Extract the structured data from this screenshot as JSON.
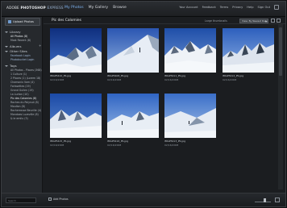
{
  "app": {
    "brand_prefix": "ADOBE",
    "brand_name": "PHOTOSHOP",
    "brand_suffix": "EXPRESS",
    "tabs": [
      {
        "label": "My Photos",
        "active": true
      },
      {
        "label": "My Gallery",
        "active": false
      },
      {
        "label": "Browse",
        "active": false
      }
    ],
    "toplinks": [
      "Your Account",
      "Feedback",
      "Terms",
      "Privacy",
      "Help",
      "Sign Out"
    ]
  },
  "sidebar": {
    "upload_label": "Upload Photos",
    "sections": [
      {
        "label": "Library",
        "items": [
          {
            "label": "All Photos (8)",
            "active": true
          },
          {
            "label": "Most Recent (8)",
            "active": false
          }
        ]
      },
      {
        "label": "Albums",
        "items": []
      },
      {
        "label": "Other Sites",
        "items": [
          {
            "label": "Facebook Login",
            "link": true
          },
          {
            "label": "Photobucket Login",
            "link": true
          }
        ]
      },
      {
        "label": "Tags",
        "items": [
          {
            "label": "All Photos - Places (368)"
          },
          {
            "label": "1 Culture (1)"
          },
          {
            "label": "2 Places (1) (Lorem 18)"
          },
          {
            "label": "Chamonix Vom (4)"
          },
          {
            "label": "Forissettes (19)"
          },
          {
            "label": "Grand Gullen (19)"
          },
          {
            "label": "La Lurtan (10)"
          },
          {
            "label": "Pic des Calomies (8)"
          },
          {
            "label": "Roches du Polyrud (8)"
          },
          {
            "label": "Moullon (8)"
          },
          {
            "label": "Rocherrosse Beurille (4)"
          },
          {
            "label": "Mondoes Luzeville (8)"
          },
          {
            "label": "& le emilu (3)"
          }
        ]
      }
    ]
  },
  "main": {
    "album_title": "Pic des Calomies",
    "view_label": "Large thumbnails",
    "sort_value": "View: By Newest Date",
    "photos": [
      {
        "filename": "IMGP5410_PS.jpg",
        "date": "02/16/2008"
      },
      {
        "filename": "IMGP5408_PS.jpg",
        "date": "02/16/2008"
      },
      {
        "filename": "IMGP5411_PS.jpg",
        "date": "02/16/2008"
      },
      {
        "filename": "IMGP5412_PS.jpg",
        "date": "02/16/2008"
      },
      {
        "filename": "IMGP5415_PS.jpg",
        "date": "02/16/2008"
      },
      {
        "filename": "IMGP5416_PS.jpg",
        "date": "02/16/2008"
      },
      {
        "filename": "IMGP5413_PS.jpg",
        "date": "02/16/2008"
      }
    ]
  },
  "bottombar": {
    "search_placeholder": "Search",
    "add_photos_label": "Add Photos"
  },
  "icons": {
    "upload": "upload-icon",
    "grid": "grid-view-icon",
    "list": "list-view-icon",
    "cursor": "move-cursor-icon",
    "zoom": "zoom-icon"
  },
  "colors": {
    "accent": "#7db2ee",
    "background": "#1b1d20",
    "sidebar": "#26292d"
  }
}
